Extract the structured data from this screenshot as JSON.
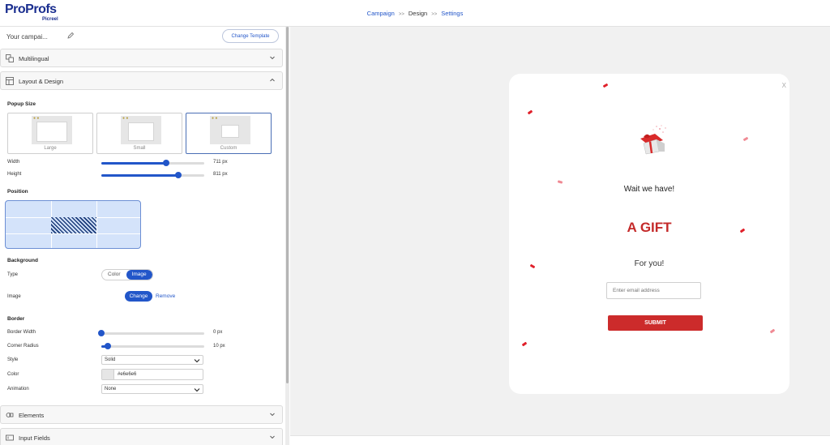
{
  "header": {
    "logo_main": "ProProfs",
    "logo_sub": "Picreel",
    "breadcrumb": [
      {
        "label": "Campaign",
        "active": false
      },
      {
        "label": "Design",
        "active": true
      },
      {
        "label": "Settings",
        "active": false
      }
    ],
    "breadcrumb_separator": ">>"
  },
  "sidebar": {
    "campaign_name": "Your campai...",
    "change_template_label": "Change Template",
    "sections": {
      "multilingual": "Multilingual",
      "layout_design": "Layout & Design",
      "elements": "Elements",
      "input_fields": "Input Fields"
    },
    "popup_size": {
      "title": "Popup Size",
      "options": [
        "Large",
        "Small",
        "Custom"
      ],
      "selected": "Custom",
      "width_label": "Width",
      "width_value": "711 px",
      "width_fraction": 0.63,
      "height_label": "Height",
      "height_value": "811 px",
      "height_fraction": 0.75
    },
    "position": {
      "title": "Position",
      "selected_cell": "center"
    },
    "background": {
      "title": "Background",
      "type_label": "Type",
      "type_options": [
        "Color",
        "Image"
      ],
      "type_selected": "Image",
      "image_label": "Image",
      "change_label": "Change",
      "remove_label": "Remove"
    },
    "border": {
      "title": "Border",
      "width_label": "Border Width",
      "width_value": "0 px",
      "width_fraction": 0.0,
      "radius_label": "Corner Radius",
      "radius_value": "10 px",
      "radius_fraction": 0.06,
      "style_label": "Style",
      "style_value": "Solid",
      "color_label": "Color",
      "color_value": "#e6e6e6",
      "animation_label": "Animation",
      "animation_value": "None"
    }
  },
  "popup": {
    "close": "X",
    "heading": "Wait we have!",
    "gift_text": "A GIFT",
    "subtext": "For you!",
    "email_placeholder": "Enter email address",
    "submit_label": "SUBMIT"
  },
  "colors": {
    "accent": "#2256c9",
    "gift_red": "#c42a2a",
    "submit_red": "#cc2b2b"
  }
}
